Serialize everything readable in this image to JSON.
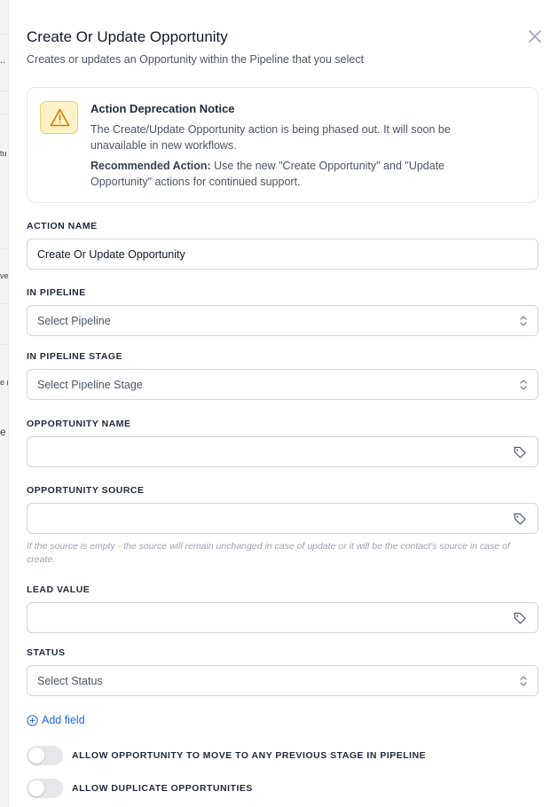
{
  "background": {
    "fragments": [
      "..",
      "tu",
      "ve",
      "e (",
      "e"
    ]
  },
  "header": {
    "title": "Create Or Update Opportunity",
    "subtitle": "Creates or updates an Opportunity within the Pipeline that you select",
    "close_icon": "close-icon"
  },
  "notice": {
    "icon": "warning-triangle-icon",
    "title": "Action Deprecation Notice",
    "body": "The Create/Update Opportunity action is being phased out. It will soon be unavailable in new workflows.",
    "rec_label": "Recommended Action:",
    "rec_text": " Use the new \"Create Opportunity\" and \"Update Opportunity\" actions for continued support.",
    "accent": "#f59e0b"
  },
  "form": {
    "action_name": {
      "label": "ACTION NAME",
      "value": "Create Or Update Opportunity"
    },
    "pipeline": {
      "label": "IN PIPELINE",
      "placeholder": "Select Pipeline"
    },
    "pipeline_stage": {
      "label": "IN PIPELINE STAGE",
      "placeholder": "Select Pipeline Stage"
    },
    "opportunity_name": {
      "label": "OPPORTUNITY NAME",
      "value": ""
    },
    "opportunity_source": {
      "label": "OPPORTUNITY SOURCE",
      "value": "",
      "hint": "If the source is empty - the source will remain unchanged in case of update or it will be the contact's source in case of create."
    },
    "lead_value": {
      "label": "LEAD VALUE",
      "value": ""
    },
    "status": {
      "label": "STATUS",
      "placeholder": "Select Status"
    },
    "add_field": "Add field",
    "toggles": [
      {
        "label": "ALLOW OPPORTUNITY TO MOVE TO ANY PREVIOUS STAGE IN PIPELINE",
        "on": false
      },
      {
        "label": "ALLOW DUPLICATE OPPORTUNITIES",
        "on": false
      }
    ]
  },
  "colors": {
    "link": "#2563eb",
    "warning_bg": "#fef3c7"
  }
}
